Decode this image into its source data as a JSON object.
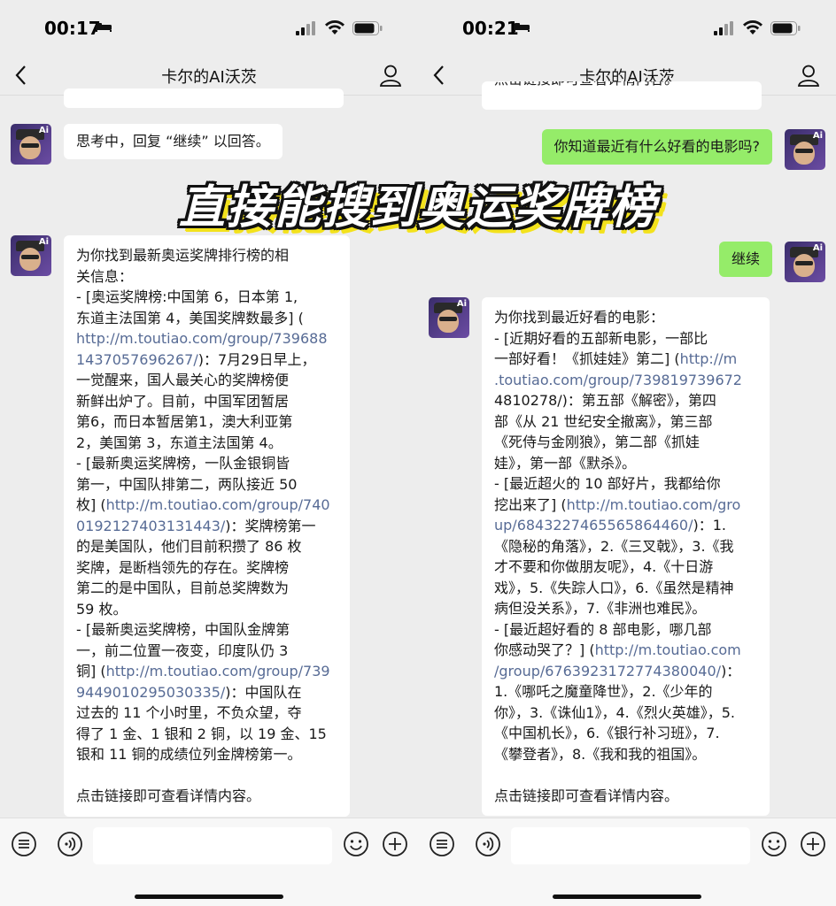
{
  "banner": "直接能搜到奥运奖牌榜",
  "colors": {
    "accent_green": "#95ec69",
    "link": "#576b95",
    "bg": "#ededed"
  },
  "left": {
    "status": {
      "time": "00:17"
    },
    "nav": {
      "title": "卡尔的AI沃茨"
    },
    "messages": {
      "m1": "思考中，回复 “继续” 以回答。",
      "m2_lines": [
        "为你找到最新奥运奖牌排行榜的相",
        "关信息：",
        "- [奥运奖牌榜:中国第 6，日本第 1,",
        "东道主法国第 4，美国奖牌数最多] (",
        "http://m.toutiao.com/group/739688",
        "1437057696267/)：7月29日早上，",
        "一觉醒来，国人最关心的奖牌榜便",
        "新鲜出炉了。目前，中国军团暂居",
        "第6，而日本暂居第1，澳大利亚第",
        "2，美国第 3，东道主法国第 4。",
        "- [最新奥运奖牌榜，一队金银铜皆",
        "第一，中国队排第二，两队接近 50",
        "枚] (http://m.toutiao.com/group/740",
        "0192127403131443/)：奖牌榜第一",
        "的是美国队，他们目前积攒了 86 枚",
        "奖牌，是断档领先的存在。奖牌榜",
        "第二的是中国队，目前总奖牌数为",
        "59 枚。",
        "- [最新奥运奖牌榜，中国队金牌第",
        "一，前二位置一夜变，印度队仍 3",
        "铜] (http://m.toutiao.com/group/739",
        "9449010295030335/)：中国队在",
        "过去的 11 个小时里，不负众望，夺",
        "得了 1 金、1 银和 2 铜，以 19 金、15",
        "银和 11 铜的成绩位列金牌榜第一。",
        "",
        "点击链接即可查看详情内容。"
      ]
    }
  },
  "right": {
    "status": {
      "time": "00:21"
    },
    "nav": {
      "title": "卡尔的AI沃茨"
    },
    "messages": {
      "top_clip": "点击链接即可查看详情内容。",
      "q1": "你知道最近有什么好看的电影吗?",
      "q2": "继续",
      "a_lines": [
        "为你找到最近好看的电影：",
        "- [近期好看的五部新电影，一部比",
        "一部好看！《抓娃娃》第二] (http://m",
        ".toutiao.com/group/739819739672",
        "4810278/)：第五部《解密》，第四",
        "部《从 21 世纪安全撤离》，第三部",
        "《死侍与金刚狼》，第二部《抓娃",
        "娃》，第一部《默杀》。",
        "- [最近超火的 10 部好片，我都给你",
        "挖出来了] (http://m.toutiao.com/gro",
        "up/6843227465565864460/)：1.",
        "《隐秘的角落》，2.《三叉戟》，3.《我",
        "才不要和你做朋友呢》，4.《十日游",
        "戏》，5.《失踪人口》，6.《虽然是精神",
        "病但没关系》，7.《非洲也难民》。",
        "- [最近超好看的 8 部电影，哪几部",
        "你感动哭了？] (http://m.toutiao.com",
        "/group/6763923172774380040/)：",
        "1.《哪吒之魔童降世》，2.《少年的",
        "你》，3.《诛仙1》，4.《烈火英雄》，5.",
        "《中国机长》，6.《银行补习班》，7.",
        "《攀登者》，8.《我和我的祖国》。",
        "",
        "点击链接即可查看详情内容。"
      ]
    }
  }
}
